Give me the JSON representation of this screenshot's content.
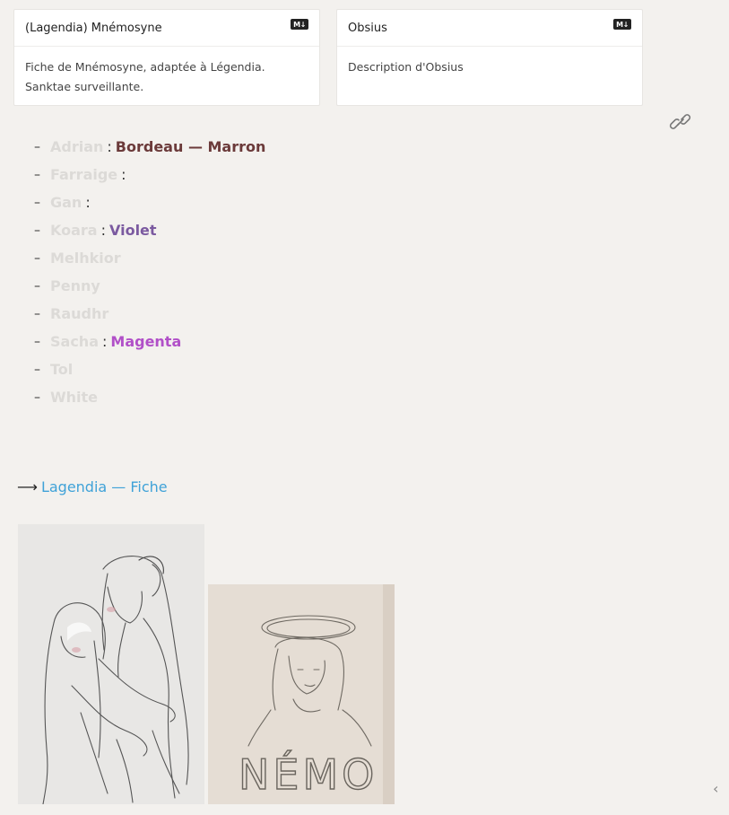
{
  "cards": [
    {
      "title": "(Lagendia) Mnémosyne",
      "badge": "M↓",
      "description_lines": [
        "Fiche de Mnémosyne, adaptée à Légendia.",
        "Sanktae surveillante."
      ]
    },
    {
      "title": "Obsius",
      "badge": "M↓",
      "description_lines": [
        "Description d'Obsius"
      ]
    }
  ],
  "link_icon": "link-icon",
  "characters": [
    {
      "name": "Adrian",
      "sep": ":",
      "value": "Bordeau — Marron",
      "color": "#6b3a3a"
    },
    {
      "name": "Farraige",
      "sep": ":",
      "value": "",
      "color": ""
    },
    {
      "name": "Gan",
      "sep": ":",
      "value": "",
      "color": ""
    },
    {
      "name": "Koara",
      "sep": ":",
      "value": "Violet",
      "color": "#7b5aa0"
    },
    {
      "name": "Melhkior",
      "sep": "",
      "value": "",
      "color": ""
    },
    {
      "name": "Penny",
      "sep": "",
      "value": "",
      "color": ""
    },
    {
      "name": "Raudhr",
      "sep": "",
      "value": "",
      "color": ""
    },
    {
      "name": "Sacha",
      "sep": ":",
      "value": "Magenta",
      "color": "#b150c8"
    },
    {
      "name": "Tol",
      "sep": "",
      "value": "",
      "color": ""
    },
    {
      "name": "White",
      "sep": "",
      "value": "",
      "color": ""
    }
  ],
  "dash": "–",
  "fiche": {
    "arrow": "⟶",
    "link_text": "Lagendia — Fiche"
  },
  "images": [
    {
      "name": "sketch-couple-image"
    },
    {
      "name": "sketch-nemo-image",
      "inscription": "NÉMO"
    }
  ],
  "chevron": "‹"
}
